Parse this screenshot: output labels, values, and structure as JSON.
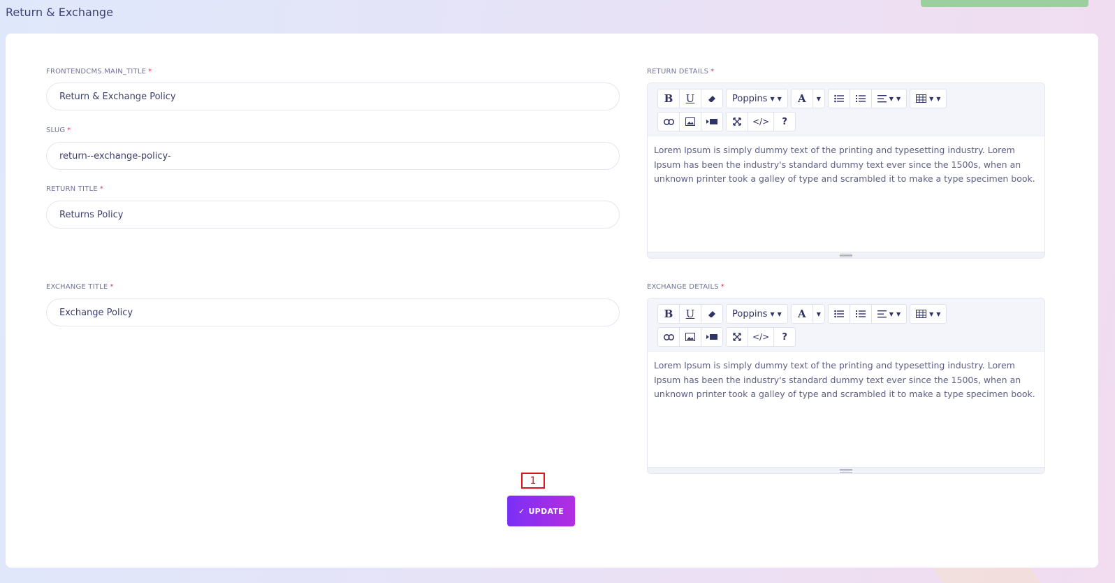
{
  "page": {
    "title": "Return & Exchange"
  },
  "form": {
    "main_title": {
      "label": "FRONTENDCMS.MAIN_TITLE",
      "required": "*",
      "value": "Return & Exchange Policy"
    },
    "slug": {
      "label": "SLUG",
      "required": "*",
      "value": "return--exchange-policy-"
    },
    "return_title": {
      "label": "RETURN TITLE",
      "required": "*",
      "value": "Returns Policy"
    },
    "exchange_title": {
      "label": "EXCHANGE TITLE",
      "required": "*",
      "value": "Exchange Policy"
    },
    "return_details": {
      "label": "RETURN DETAILS",
      "required": "*",
      "content": "Lorem Ipsum is simply dummy text of the printing and typesetting industry. Lorem Ipsum has been the industry's standard dummy text ever since the 1500s, when an unknown printer took a galley of type and scrambled it to make a type specimen book."
    },
    "exchange_details": {
      "label": "EXCHANGE DETAILS",
      "required": "*",
      "content": "Lorem Ipsum is simply dummy text of the printing and typesetting industry. Lorem Ipsum has been the industry's standard dummy text ever since the 1500s, when an unknown printer took a galley of type and scrambled it to make a type specimen book."
    }
  },
  "toolbar": {
    "bold": "B",
    "underline": "U",
    "font_name": "Poppins",
    "font_color": "A",
    "help": "?",
    "code": "</>"
  },
  "actions": {
    "update_label": "UPDATE",
    "update_icon": "✓"
  },
  "annotation": {
    "marker_label": "1"
  },
  "colors": {
    "accent_start": "#7b2ff7",
    "accent_end": "#b32ee0",
    "required": "#e0355c",
    "marker": "#e0141c"
  }
}
